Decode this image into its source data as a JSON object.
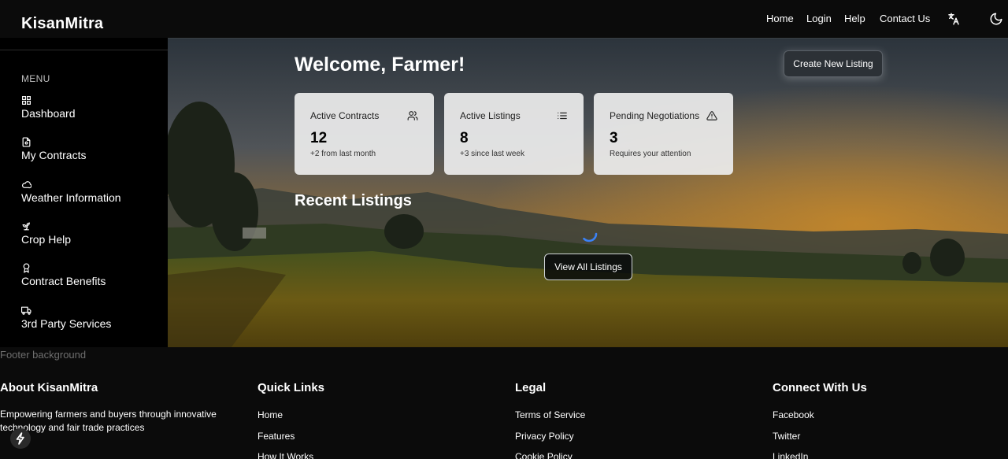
{
  "brand": "KisanMitra",
  "nav": {
    "links": [
      "Home",
      "Login",
      "Help",
      "Contact Us"
    ],
    "icons": [
      "translate-icon",
      "moon-icon"
    ]
  },
  "sidebar": {
    "menu_label": "MENU",
    "items": [
      {
        "label": "Dashboard",
        "icon": "grid-icon"
      },
      {
        "label": "My Contracts",
        "icon": "document-icon"
      },
      {
        "label": "Weather Information",
        "icon": "cloud-icon"
      },
      {
        "label": "Crop Help",
        "icon": "sprout-icon"
      },
      {
        "label": "Contract Benefits",
        "icon": "award-icon"
      },
      {
        "label": "3rd Party Services",
        "icon": "truck-icon"
      }
    ]
  },
  "main": {
    "welcome": "Welcome, Farmer!",
    "create_button": "Create New Listing",
    "cards": [
      {
        "title": "Active Contracts",
        "value": "12",
        "sub": "+2 from last month",
        "icon": "users-icon"
      },
      {
        "title": "Active Listings",
        "value": "8",
        "sub": "+3 since last week",
        "icon": "list-icon"
      },
      {
        "title": "Pending Negotiations",
        "value": "3",
        "sub": "Requires your attention",
        "icon": "alert-triangle-icon"
      }
    ],
    "recent_heading": "Recent Listings",
    "view_all_button": "View All Listings"
  },
  "footer": {
    "bg_label": "Footer background",
    "about": {
      "heading": "About KisanMitra",
      "text": "Empowering farmers and buyers through innovative technology and fair trade practices"
    },
    "quick_links": {
      "heading": "Quick Links",
      "links": [
        "Home",
        "Features",
        "How It Works"
      ]
    },
    "legal": {
      "heading": "Legal",
      "links": [
        "Terms of Service",
        "Privacy Policy",
        "Cookie Policy"
      ]
    },
    "connect": {
      "heading": "Connect With Us",
      "links": [
        "Facebook",
        "Twitter",
        "LinkedIn"
      ]
    }
  },
  "colors": {
    "background": "#0b0b0b",
    "sidebar": "#000000",
    "card": "#ececec",
    "spinner": "#3b82f6"
  }
}
